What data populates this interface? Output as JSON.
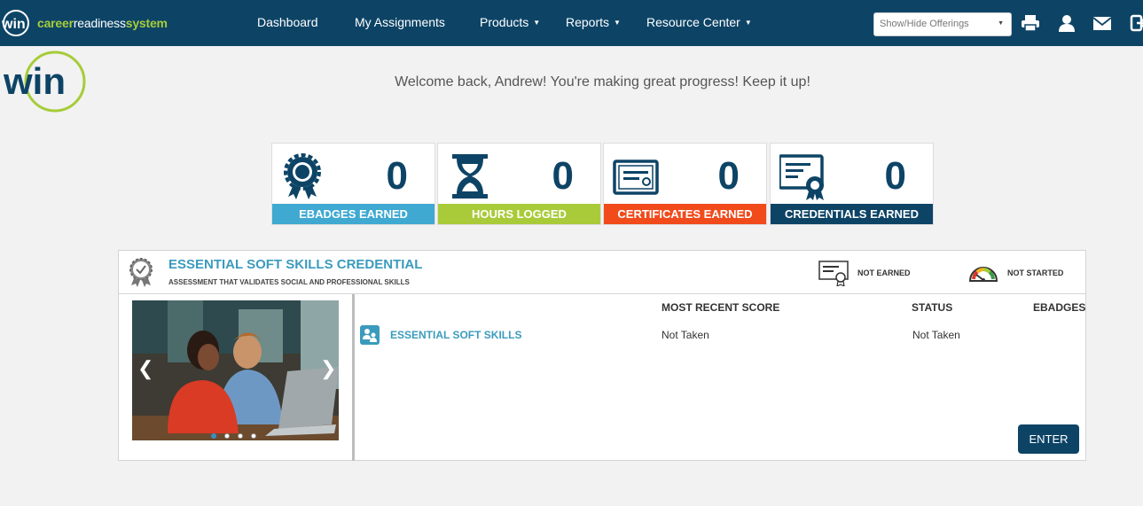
{
  "brand": {
    "part1": "career",
    "part2": "readiness",
    "part3": "system"
  },
  "nav": {
    "items": [
      {
        "label": "Dashboard"
      },
      {
        "label": "My Assignments"
      },
      {
        "label": "Products"
      },
      {
        "label": "Reports"
      },
      {
        "label": "Resource Center"
      }
    ],
    "offerings_select": "Show/Hide Offerings",
    "icons": [
      "print-icon",
      "user-icon",
      "mail-icon",
      "logout-icon"
    ]
  },
  "welcome": "Welcome back, Andrew! You're making great progress! Keep it up!",
  "stats": [
    {
      "value": "0",
      "label": "EBADGES EARNED",
      "color": "#3fa9d1",
      "icon": "badge-icon"
    },
    {
      "value": "0",
      "label": "HOURS LOGGED",
      "color": "#a9cb3a",
      "icon": "hourglass-icon"
    },
    {
      "value": "0",
      "label": "CERTIFICATES EARNED",
      "color": "#f14b1c",
      "icon": "certificate-icon"
    },
    {
      "value": "0",
      "label": "CREDENTIALS EARNED",
      "color": "#0d4466",
      "icon": "credential-icon"
    }
  ],
  "credential": {
    "title": "ESSENTIAL SOFT SKILLS CREDENTIAL",
    "subtitle": "ASSESSMENT THAT VALIDATES SOCIAL AND PROFESSIONAL SKILLS",
    "earned_status": "NOT EARNED",
    "progress_status": "NOT STARTED",
    "columns": {
      "score": "MOST RECENT SCORE",
      "status": "STATUS",
      "ebadges": "EBADGES"
    },
    "rows": [
      {
        "name": "ESSENTIAL SOFT SKILLS",
        "score": "Not Taken",
        "status": "Not Taken"
      }
    ],
    "enter_label": "ENTER",
    "carousel_slide": 1,
    "carousel_total": 4
  },
  "colors": {
    "navy": "#0d4466",
    "accent": "#3b9bbd",
    "green": "#a6cc39"
  }
}
